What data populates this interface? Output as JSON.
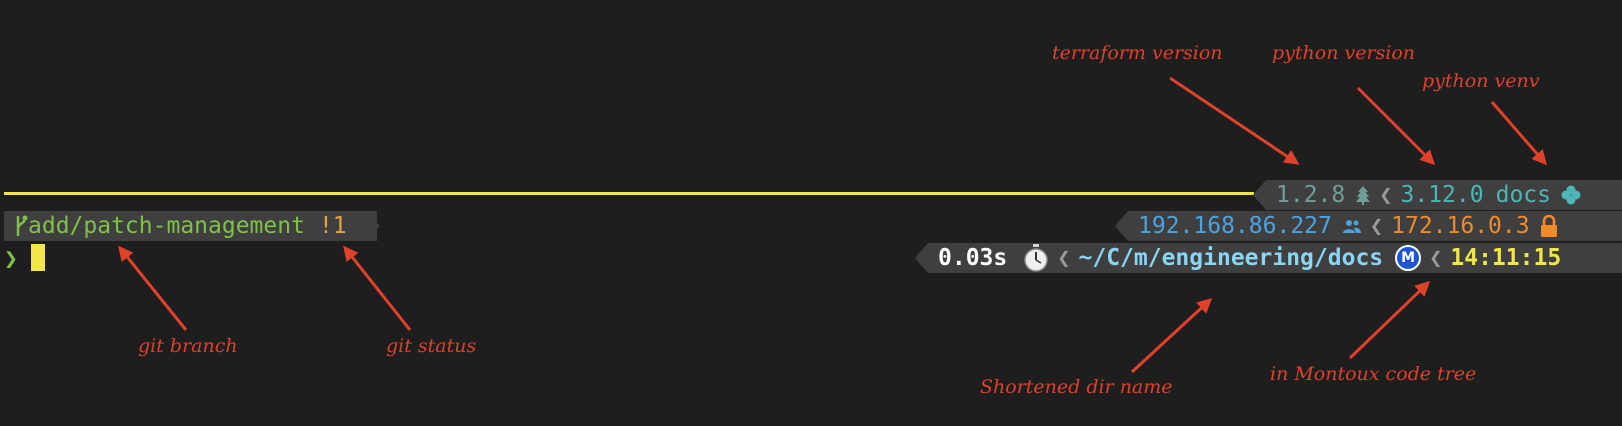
{
  "colors": {
    "background": "#1e1e1e",
    "segment_bg": "#3f3f3f",
    "ruler": "#f1e64a",
    "terraform": "#6e9e9a",
    "python": "#4bb7b8",
    "git_branch": "#7fc24a",
    "git_status": "#e2a14a",
    "ip_local": "#4ba3e0",
    "ip_vpn": "#f08a2a",
    "duration": "#ffffff",
    "directory": "#8ad4f4",
    "time": "#f1e64a",
    "annotation": "#e0412b"
  },
  "prompt": {
    "git_branch": "add/patch-management",
    "git_status": "!1",
    "prompt_char": "❯"
  },
  "right_prompt": {
    "line1": {
      "terraform_version": "1.2.8",
      "python_version": "3.12.0",
      "python_venv": "docs"
    },
    "line2": {
      "local_ip": "192.168.86.227",
      "vpn_ip": "172.16.0.3"
    },
    "line3": {
      "duration": "0.03s",
      "directory": "~/C/m/engineering/docs",
      "montoux_badge": "M",
      "time": "14:11:15"
    }
  },
  "icons": {
    "git": "git-branch-icon",
    "terraform": "tree-icon",
    "venv": "python-icon",
    "network": "people-icon",
    "vpn": "lock-icon",
    "duration": "stopwatch-icon",
    "montoux": "m-badge-icon",
    "separator": "chevron-left-icon"
  },
  "annotations": {
    "terraform_version": "terraform version",
    "python_version": "python version",
    "python_venv": "python venv",
    "git_branch": "git branch",
    "git_status": "git status",
    "shortened_dir": "Shortened dir name",
    "montoux": "in Montoux code tree"
  }
}
